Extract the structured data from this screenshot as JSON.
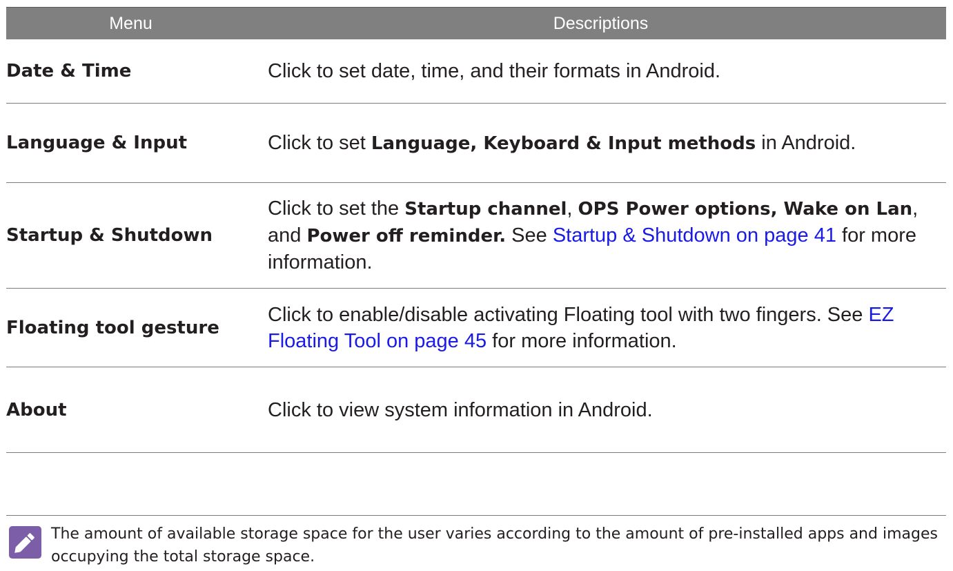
{
  "header": {
    "menu": "Menu",
    "descriptions": "Descriptions"
  },
  "rows": [
    {
      "menu": "Date & Time",
      "desc": [
        {
          "t": "Click to set date, time, and their formats in Android."
        }
      ]
    },
    {
      "menu": "Language & Input",
      "desc": [
        {
          "t": "Click to set "
        },
        {
          "t": "Language, Keyboard & Input methods",
          "b": true
        },
        {
          "t": " in Android."
        }
      ]
    },
    {
      "menu": "Startup & Shutdown",
      "desc": [
        {
          "t": "Click to set the "
        },
        {
          "t": "Startup channel",
          "b": true
        },
        {
          "t": ", "
        },
        {
          "t": "OPS Power options, Wake on Lan",
          "b": true
        },
        {
          "t": ", and "
        },
        {
          "t": "Power off reminder.",
          "b": true
        },
        {
          "t": " See "
        },
        {
          "t": "Startup & Shutdown on page 41",
          "link": true
        },
        {
          "t": " for more information."
        }
      ]
    },
    {
      "menu": "Floating tool gesture",
      "desc": [
        {
          "t": "Click to enable/disable activating Floating tool with two fingers. See "
        },
        {
          "t": "EZ Floating Tool on page 45",
          "link": true
        },
        {
          "t": " for more information."
        }
      ]
    },
    {
      "menu": "About",
      "desc": [
        {
          "t": "Click to view system information in Android."
        }
      ]
    }
  ],
  "note": {
    "icon": "pencil-note-icon",
    "text": "The amount of available storage space for the user varies according to the amount of pre-installed apps and images occupying the total storage space."
  },
  "colors": {
    "header_bg": "#808080",
    "link": "#1a1ae6",
    "icon_bg": "#7b5ea7"
  }
}
